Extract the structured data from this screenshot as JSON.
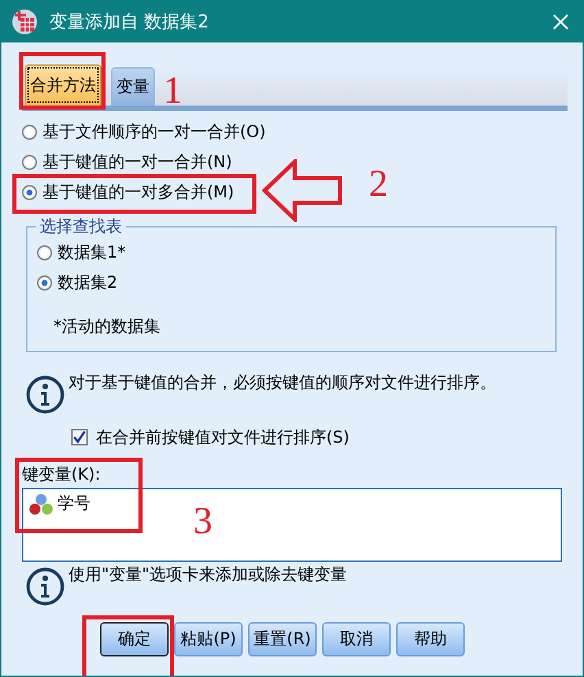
{
  "window": {
    "title": "变量添加自 数据集2"
  },
  "tabs": [
    {
      "label": "合并方法",
      "selected": true
    },
    {
      "label": "变量",
      "selected": false
    }
  ],
  "merge_methods": [
    {
      "label": "基于文件顺序的一对一合并(O)",
      "selected": false
    },
    {
      "label": "基于键值的一对一合并(N)",
      "selected": false
    },
    {
      "label": "基于键值的一对多合并(M)",
      "selected": true
    }
  ],
  "lookup_group": {
    "title": "选择查找表",
    "options": [
      {
        "label": "数据集1*",
        "selected": false
      },
      {
        "label": "数据集2",
        "selected": true
      }
    ],
    "note": "*活动的数据集"
  },
  "info_sort": "对于基于键值的合并，必须按键值的顺序对文件进行排序。",
  "sort_checkbox": {
    "label": "在合并前按键值对文件进行排序(S)",
    "checked": true
  },
  "key_variables": {
    "label": "键变量(K):",
    "items": [
      {
        "name": "学号"
      }
    ]
  },
  "info_keys": "使用\"变量\"选项卡来添加或除去键变量",
  "buttons": [
    {
      "label": "确定",
      "default": true
    },
    {
      "label": "粘贴(P)",
      "default": false
    },
    {
      "label": "重置(R)",
      "default": false
    },
    {
      "label": "取消",
      "default": false
    },
    {
      "label": "帮助",
      "default": false
    }
  ],
  "annotations": [
    {
      "text": "1"
    },
    {
      "text": "2"
    },
    {
      "text": "3"
    }
  ]
}
